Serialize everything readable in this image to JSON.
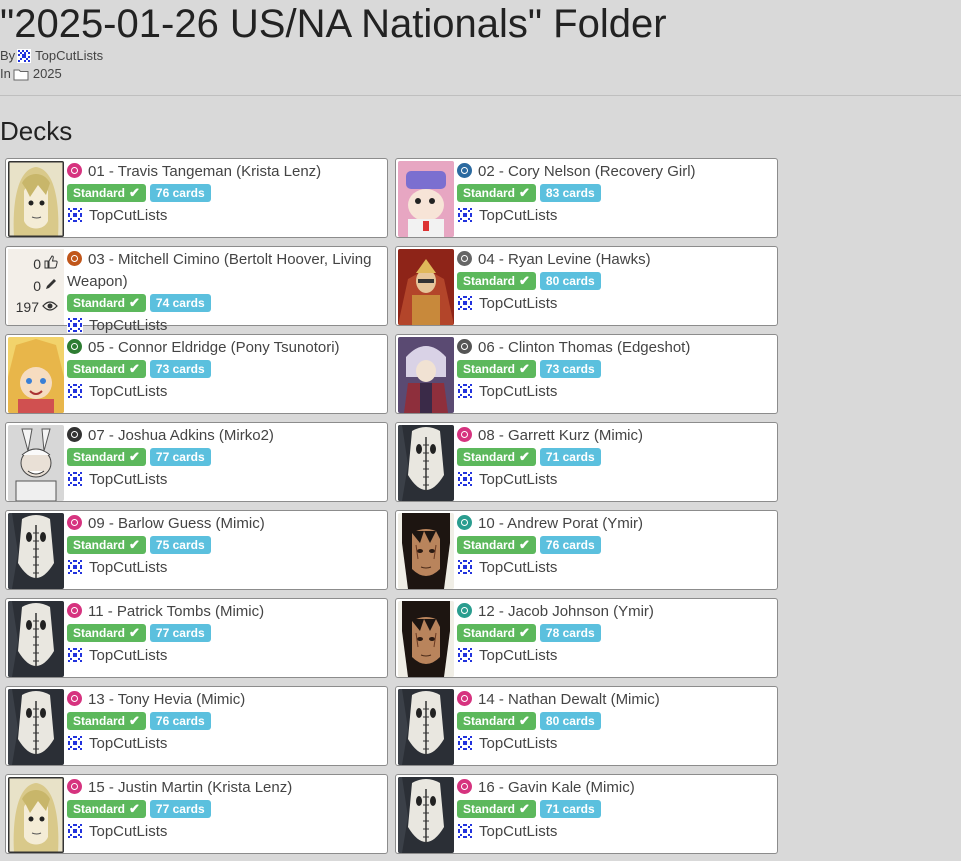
{
  "page": {
    "title": "\"2025-01-26 US/NA Nationals\" Folder",
    "by_label": "By",
    "author": "TopCutLists",
    "in_label": "In",
    "folder": "2025",
    "section_title": "Decks"
  },
  "stats": {
    "likes": "0",
    "edits": "0",
    "views": "197"
  },
  "decks": [
    {
      "title": "01 - Travis Tangeman (Krista Lenz)",
      "format": "Standard",
      "cards": "76 cards",
      "author": "TopCutLists",
      "faction_color": "#d6337f",
      "art": "blonde"
    },
    {
      "title": "02 - Cory Nelson (Recovery Girl)",
      "format": "Standard",
      "cards": "83 cards",
      "author": "TopCutLists",
      "faction_color": "#2b6aa0",
      "art": "nurse"
    },
    {
      "title": "03 - Mitchell Cimino (Bertolt Hoover, Living Weapon)",
      "format": "Standard",
      "cards": "74 cards",
      "author": "TopCutLists",
      "faction_color": "#c0561a",
      "art": "stats"
    },
    {
      "title": "04 - Ryan Levine (Hawks)",
      "format": "Standard",
      "cards": "80 cards",
      "author": "TopCutLists",
      "faction_color": "#666666",
      "art": "hawks"
    },
    {
      "title": "05 - Connor Eldridge (Pony Tsunotori)",
      "format": "Standard",
      "cards": "73 cards",
      "author": "TopCutLists",
      "faction_color": "#2e7d32",
      "art": "pony"
    },
    {
      "title": "06 - Clinton Thomas (Edgeshot)",
      "format": "Standard",
      "cards": "73 cards",
      "author": "TopCutLists",
      "faction_color": "#555555",
      "art": "edgeshot"
    },
    {
      "title": "07 - Joshua Adkins (Mirko2)",
      "format": "Standard",
      "cards": "77 cards",
      "author": "TopCutLists",
      "faction_color": "#333333",
      "art": "mirko"
    },
    {
      "title": "08 - Garrett Kurz (Mimic)",
      "format": "Standard",
      "cards": "71 cards",
      "author": "TopCutLists",
      "faction_color": "#d6337f",
      "art": "mimic"
    },
    {
      "title": "09 - Barlow Guess (Mimic)",
      "format": "Standard",
      "cards": "75 cards",
      "author": "TopCutLists",
      "faction_color": "#d6337f",
      "art": "mimic"
    },
    {
      "title": "10 - Andrew Porat (Ymir)",
      "format": "Standard",
      "cards": "76 cards",
      "author": "TopCutLists",
      "faction_color": "#2a9d8f",
      "art": "ymir"
    },
    {
      "title": "11 - Patrick Tombs (Mimic)",
      "format": "Standard",
      "cards": "77 cards",
      "author": "TopCutLists",
      "faction_color": "#d6337f",
      "art": "mimic"
    },
    {
      "title": "12 - Jacob Johnson (Ymir)",
      "format": "Standard",
      "cards": "78 cards",
      "author": "TopCutLists",
      "faction_color": "#2a9d8f",
      "art": "ymir"
    },
    {
      "title": "13 - Tony Hevia (Mimic)",
      "format": "Standard",
      "cards": "76 cards",
      "author": "TopCutLists",
      "faction_color": "#d6337f",
      "art": "mimic"
    },
    {
      "title": "14 - Nathan Dewalt (Mimic)",
      "format": "Standard",
      "cards": "80 cards",
      "author": "TopCutLists",
      "faction_color": "#d6337f",
      "art": "mimic"
    },
    {
      "title": "15 - Justin Martin (Krista Lenz)",
      "format": "Standard",
      "cards": "77 cards",
      "author": "TopCutLists",
      "faction_color": "#d6337f",
      "art": "blonde"
    },
    {
      "title": "16 - Gavin Kale (Mimic)",
      "format": "Standard",
      "cards": "71 cards",
      "author": "TopCutLists",
      "faction_color": "#d6337f",
      "art": "mimic"
    }
  ]
}
